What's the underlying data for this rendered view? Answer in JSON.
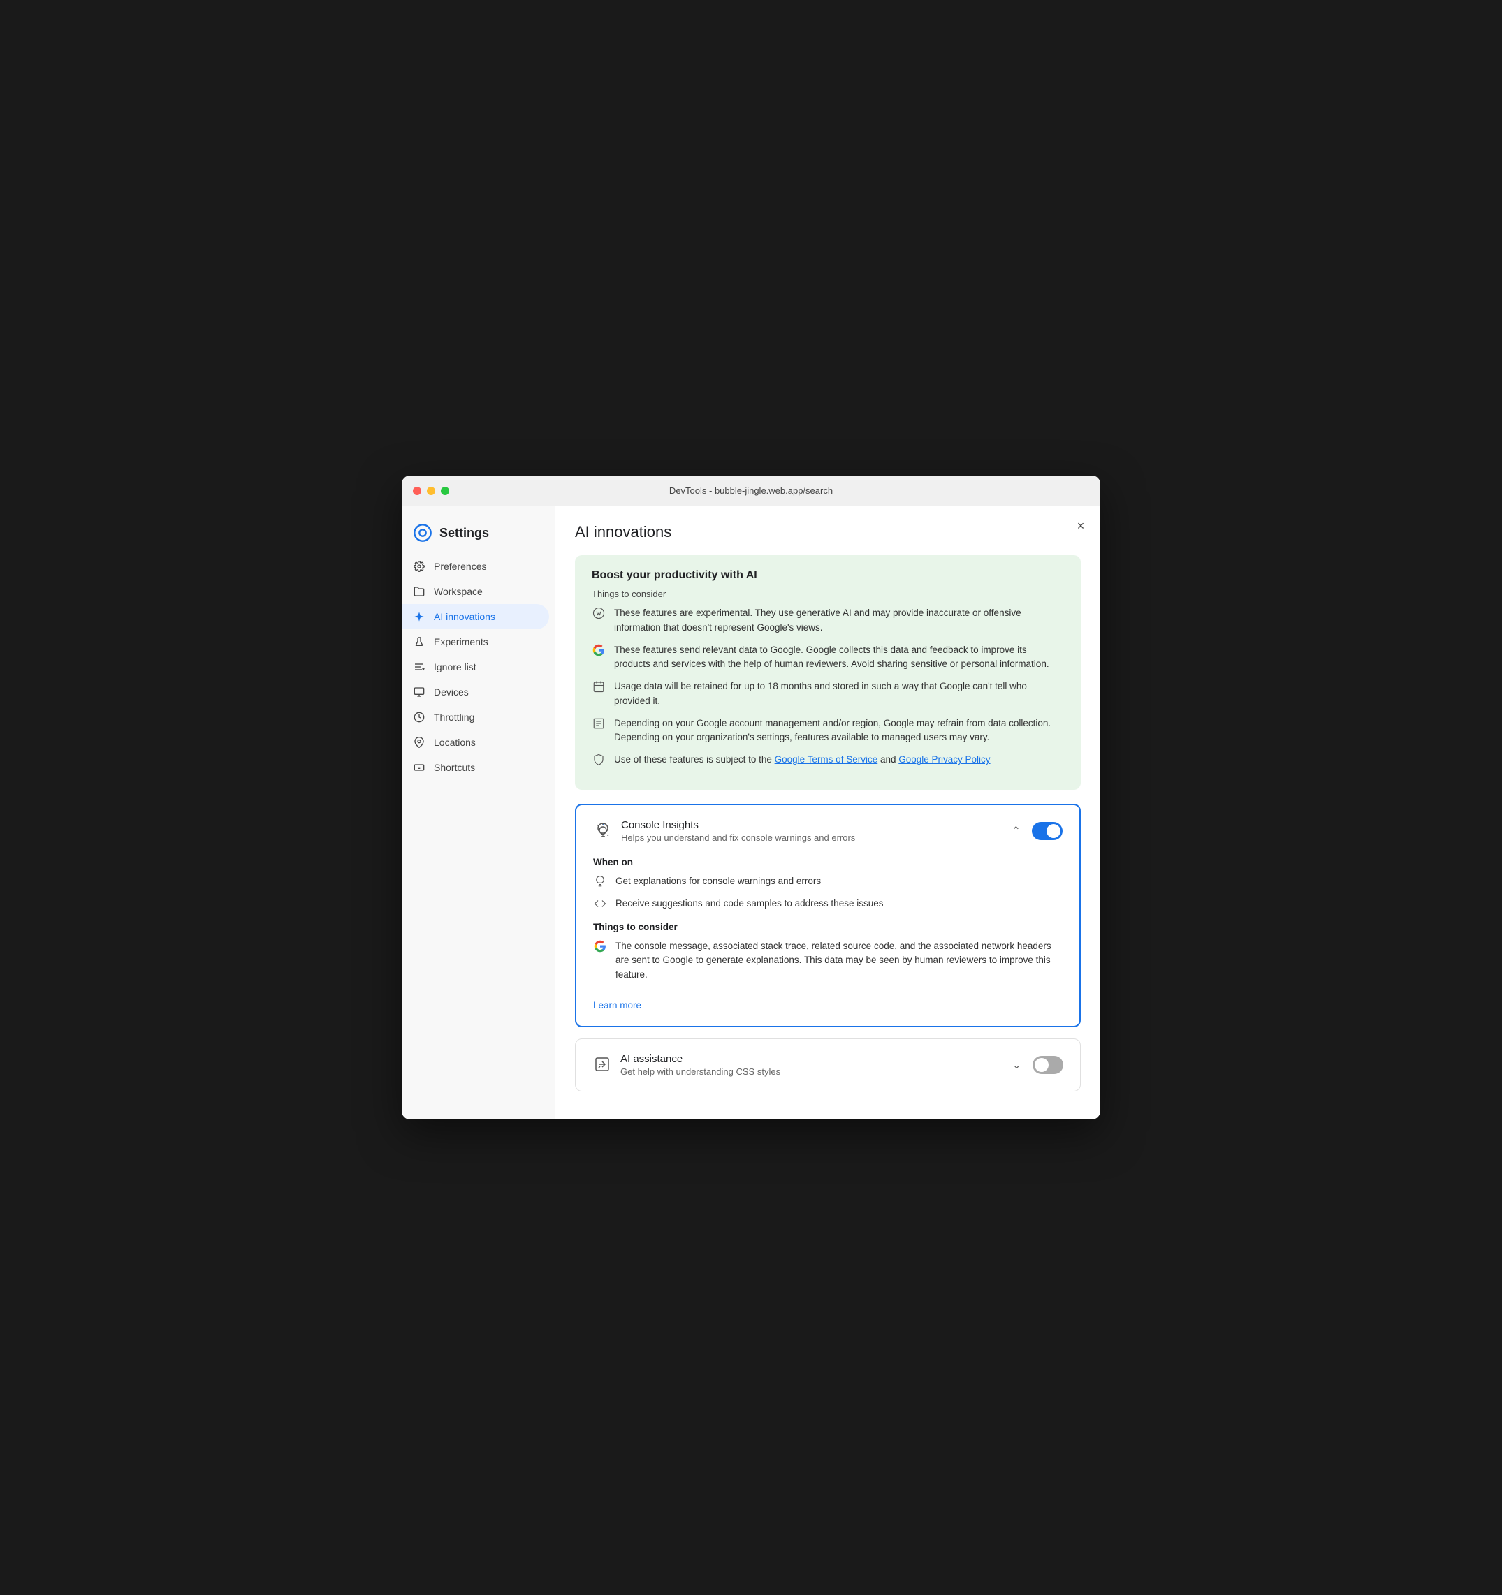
{
  "window": {
    "title": "DevTools - bubble-jingle.web.app/search"
  },
  "sidebar": {
    "header": {
      "title": "Settings"
    },
    "items": [
      {
        "id": "preferences",
        "label": "Preferences",
        "icon": "gear"
      },
      {
        "id": "workspace",
        "label": "Workspace",
        "icon": "folder"
      },
      {
        "id": "ai-innovations",
        "label": "AI innovations",
        "icon": "sparkle",
        "active": true
      },
      {
        "id": "experiments",
        "label": "Experiments",
        "icon": "flask"
      },
      {
        "id": "ignore-list",
        "label": "Ignore list",
        "icon": "ignore"
      },
      {
        "id": "devices",
        "label": "Devices",
        "icon": "device"
      },
      {
        "id": "throttling",
        "label": "Throttling",
        "icon": "throttle"
      },
      {
        "id": "locations",
        "label": "Locations",
        "icon": "pin"
      },
      {
        "id": "shortcuts",
        "label": "Shortcuts",
        "icon": "keyboard"
      }
    ]
  },
  "main": {
    "title": "AI innovations",
    "close_label": "×",
    "info_card": {
      "title": "Boost your productivity with AI",
      "subtitle": "Things to consider",
      "items": [
        {
          "text": "These features are experimental. They use generative AI and may provide inaccurate or offensive information that doesn't represent Google's views.",
          "icon": "ai-caution"
        },
        {
          "text": "These features send relevant data to Google. Google collects this data and feedback to improve its products and services with the help of human reviewers. Avoid sharing sensitive or personal information.",
          "icon": "google-g"
        },
        {
          "text": "Usage data will be retained for up to 18 months and stored in such a way that Google can't tell who provided it.",
          "icon": "calendar"
        },
        {
          "text": "Depending on your Google account management and/or region, Google may refrain from data collection. Depending on your organization's settings, features available to managed users may vary.",
          "icon": "list-alt"
        },
        {
          "text": "Use of these features is subject to the ",
          "link1": "Google Terms of Service",
          "link1_url": "#",
          "middle": " and ",
          "link2": "Google Privacy Policy",
          "link2_url": "#",
          "icon": "shield"
        }
      ]
    },
    "console_insights": {
      "title": "Console Insights",
      "description": "Helps you understand and fix console warnings and errors",
      "enabled": true,
      "expanded": true,
      "when_on": {
        "title": "When on",
        "items": [
          {
            "text": "Get explanations for console warnings and errors",
            "icon": "lightbulb"
          },
          {
            "text": "Receive suggestions and code samples to address these issues",
            "icon": "code"
          }
        ]
      },
      "things_to_consider": {
        "title": "Things to consider",
        "items": [
          {
            "text": "The console message, associated stack trace, related source code, and the associated network headers are sent to Google to generate explanations. This data may be seen by human reviewers to improve this feature.",
            "icon": "google-g"
          }
        ]
      },
      "learn_more": "Learn more",
      "learn_more_url": "#"
    },
    "ai_assistance": {
      "title": "AI assistance",
      "description": "Get help with understanding CSS styles",
      "enabled": false,
      "expanded": false
    }
  }
}
